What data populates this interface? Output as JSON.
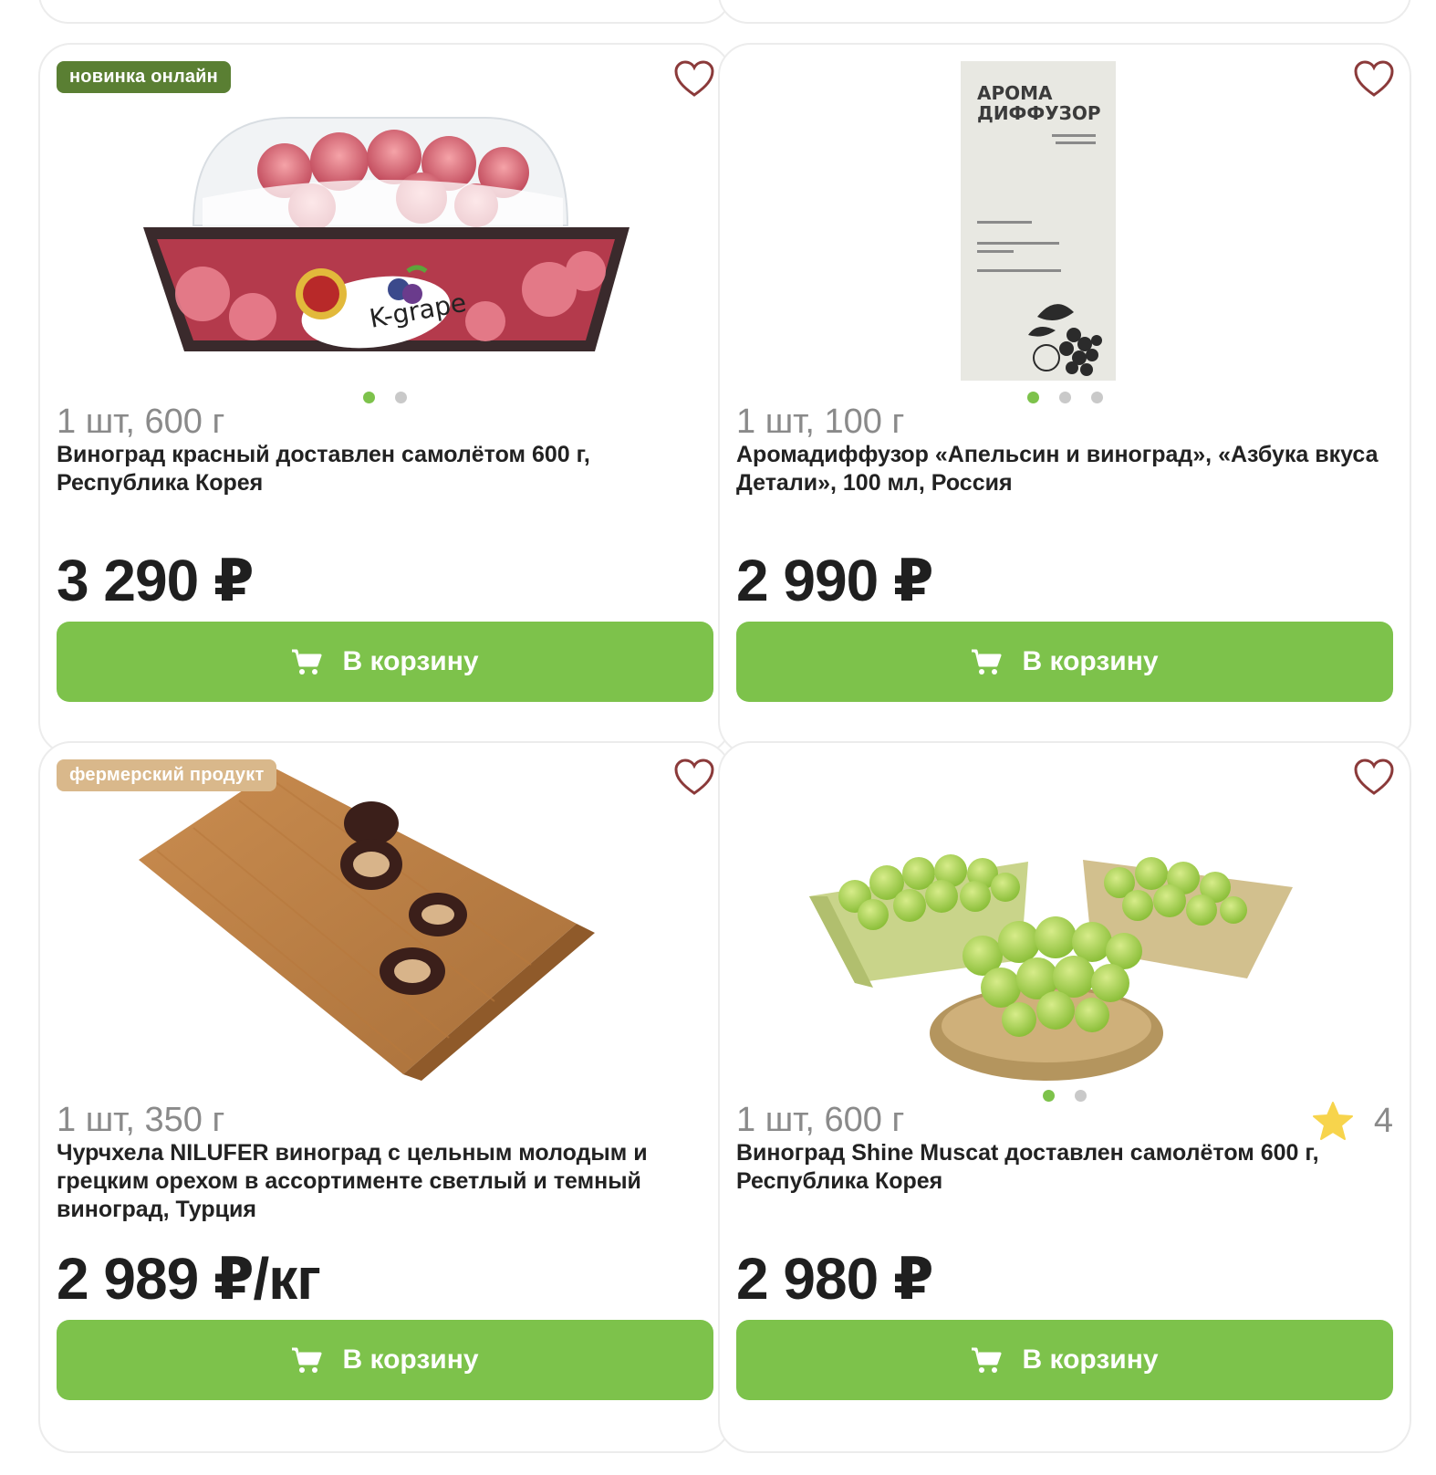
{
  "colors": {
    "accent": "#7dc24b",
    "badge_new": "#5a7f33",
    "badge_farm": "#d9b88b"
  },
  "products": [
    {
      "badge": "новинка онлайн",
      "weight": "1 шт, 600 г",
      "name": "Виноград красный доставлен самолётом 600 г, Республика Корея",
      "price": "3 290 ₽",
      "button": "В корзину",
      "image_brand": "K-grape",
      "dots": 2,
      "active_dot": 1
    },
    {
      "weight": "1 шт, 100 г",
      "name": "Аромадиффузор «Апельсин и виноград», «Азбука вкуса Детали», 100 мл, Россия",
      "price": "2 990 ₽",
      "button": "В корзину",
      "image_label_line1": "АРОМА",
      "image_label_line2": "ДИФФУЗОР",
      "dots": 3,
      "active_dot": 1
    },
    {
      "badge": "фермерский продукт",
      "weight": "1 шт, 350 г",
      "name": "Чурчхела NILUFER виноград с цельным молодым и грецким орехом в ассортименте светлый и темный виноград, Турция",
      "price": "2 989 ₽/кг",
      "button": "В корзину"
    },
    {
      "weight": "1 шт, 600 г",
      "name": "Виноград Shine Muscat доставлен самолётом 600 г, Республика Корея",
      "price": "2 980 ₽",
      "button": "В корзину",
      "rating": "4",
      "dots": 2,
      "active_dot": 1
    }
  ]
}
